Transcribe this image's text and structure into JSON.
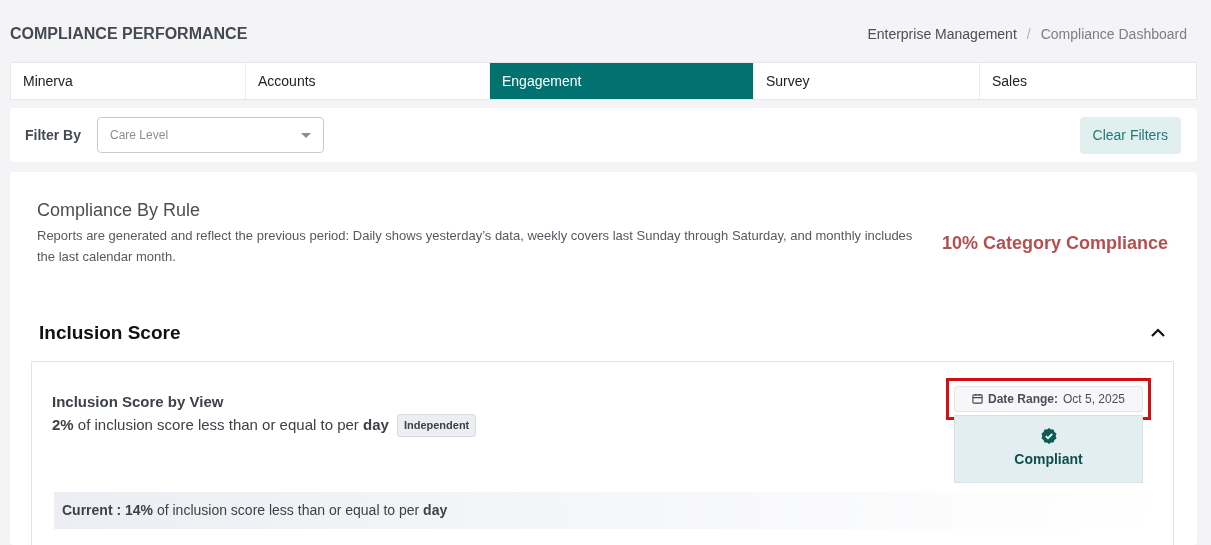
{
  "page_title": "COMPLIANCE PERFORMANCE",
  "breadcrumb": [
    {
      "label": "Enterprise Management",
      "current": false
    },
    {
      "label": "Compliance Dashboard",
      "current": true
    }
  ],
  "breadcrumb_separator": "/",
  "tabs": [
    {
      "label": "Minerva",
      "selected": false
    },
    {
      "label": "Accounts",
      "selected": false
    },
    {
      "label": "Engagement",
      "selected": true
    },
    {
      "label": "Survey",
      "selected": false
    },
    {
      "label": "Sales",
      "selected": false
    }
  ],
  "filter": {
    "label": "Filter By",
    "placeholder": "Care Level",
    "clear_button": "Clear Filters"
  },
  "section": {
    "title": "Compliance By Rule",
    "description": "Reports are generated and reflect the previous period: Daily shows yesterday’s data, weekly covers last Sunday through Saturday, and monthly includes the last calendar month.",
    "category_compliance": "10% Category Compliance"
  },
  "group": {
    "title": "Inclusion Score",
    "expanded": true,
    "rule": {
      "title": "Inclusion Score by View",
      "description": "**2%** of inclusion score less than or equal to per **day**",
      "badge": "Independent",
      "date_range": {
        "label": "Date Range:",
        "value": "Oct 5, 2025",
        "highlighted": true
      },
      "status": {
        "kind": "compliant",
        "label": "Compliant"
      },
      "current": "**Current : 14%** of inclusion score less than or equal to per **day**"
    }
  }
}
